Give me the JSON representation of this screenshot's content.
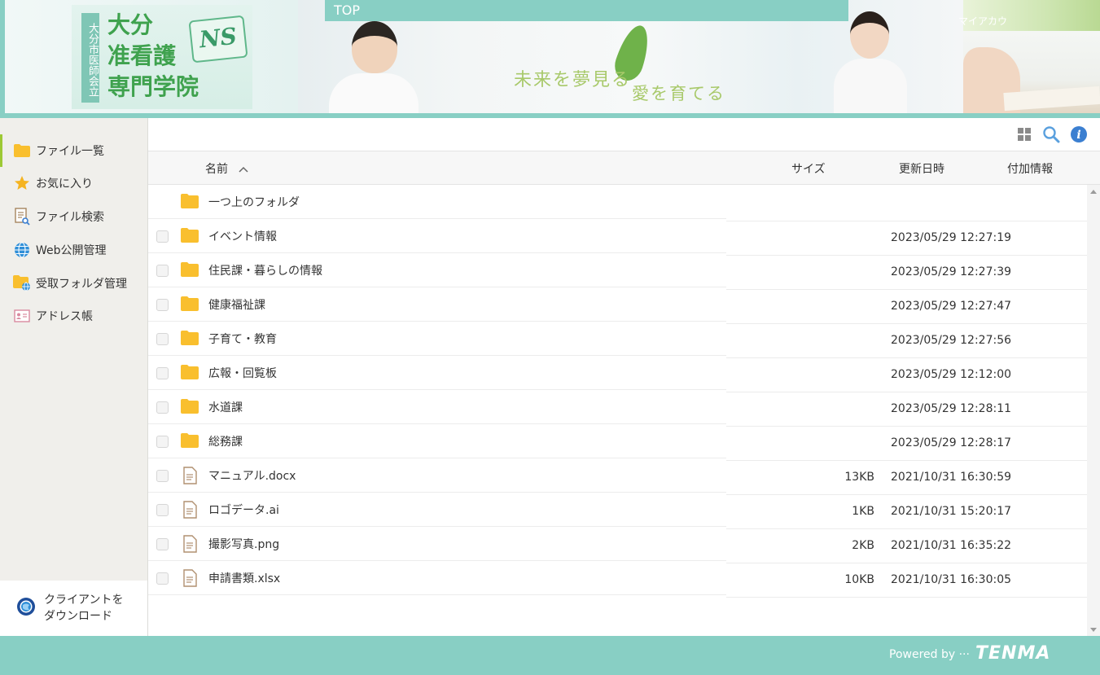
{
  "header": {
    "logo_vertical": "大分市医師会立",
    "logo_line1": "大分",
    "logo_line2": "准看護",
    "logo_line3": "専門学院",
    "logo_badge": "NS",
    "hero_text1": "未来を夢見る",
    "hero_text2": "愛を育てる",
    "top_link": "TOP",
    "my_account": "マイアカウ"
  },
  "sidebar": {
    "items": [
      {
        "label": "ファイル一覧",
        "icon": "folder-icon",
        "active": true
      },
      {
        "label": "お気に入り",
        "icon": "star-icon",
        "active": false
      },
      {
        "label": "ファイル検索",
        "icon": "file-search-icon",
        "active": false
      },
      {
        "label": "Web公開管理",
        "icon": "globe-icon",
        "active": false
      },
      {
        "label": "受取フォルダ管理",
        "icon": "receive-folder-icon",
        "active": false
      },
      {
        "label": "アドレス帳",
        "icon": "address-book-icon",
        "active": false
      }
    ],
    "download_line1": "クライアントを",
    "download_line2": "ダウンロード"
  },
  "toolbar": {
    "icons": [
      "grid-view-icon",
      "search-icon",
      "info-icon"
    ]
  },
  "columns": {
    "name": "名前",
    "size": "サイズ",
    "updated": "更新日時",
    "extra": "付加情報"
  },
  "parent_folder": "一つ上のフォルダ",
  "files": [
    {
      "name": "イベント情報",
      "type": "folder",
      "size": "",
      "date": "2023/05/29 12:27:19"
    },
    {
      "name": "住民課・暮らしの情報",
      "type": "folder",
      "size": "",
      "date": "2023/05/29 12:27:39"
    },
    {
      "name": "健康福祉課",
      "type": "folder",
      "size": "",
      "date": "2023/05/29 12:27:47"
    },
    {
      "name": "子育て・教育",
      "type": "folder",
      "size": "",
      "date": "2023/05/29 12:27:56"
    },
    {
      "name": "広報・回覧板",
      "type": "folder",
      "size": "",
      "date": "2023/05/29 12:12:00"
    },
    {
      "name": "水道課",
      "type": "folder",
      "size": "",
      "date": "2023/05/29 12:28:11"
    },
    {
      "name": "総務課",
      "type": "folder",
      "size": "",
      "date": "2023/05/29 12:28:17"
    },
    {
      "name": "マニュアル.docx",
      "type": "file",
      "size": "13KB",
      "date": "2021/10/31 16:30:59"
    },
    {
      "name": "ロゴデータ.ai",
      "type": "file",
      "size": "1KB",
      "date": "2021/10/31 15:20:17"
    },
    {
      "name": "撮影写真.png",
      "type": "file",
      "size": "2KB",
      "date": "2021/10/31 16:35:22"
    },
    {
      "name": "申請書類.xlsx",
      "type": "file",
      "size": "10KB",
      "date": "2021/10/31 16:30:05"
    }
  ],
  "footer": {
    "powered_by": "Powered by ···",
    "brand": "TENMA"
  },
  "colors": {
    "accent": "#88cfc4",
    "active_marker": "#9dc935",
    "folder": "#f9bf2e"
  }
}
